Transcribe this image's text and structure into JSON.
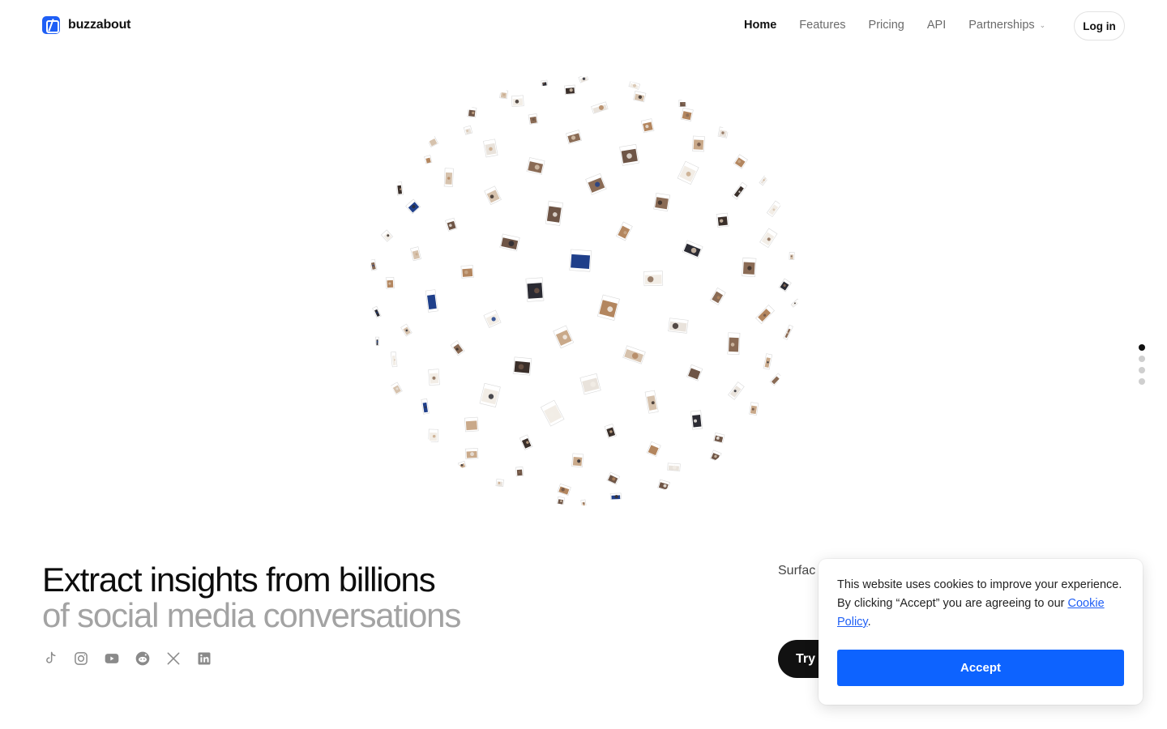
{
  "brand": {
    "name": "buzzabout"
  },
  "nav": {
    "items": [
      {
        "label": "Home",
        "active": true
      },
      {
        "label": "Features",
        "active": false
      },
      {
        "label": "Pricing",
        "active": false
      },
      {
        "label": "API",
        "active": false
      },
      {
        "label": "Partnerships",
        "active": false,
        "has_dropdown": true
      }
    ],
    "login_label": "Log in"
  },
  "hero": {
    "headline_line1": "Extract insights from billions",
    "headline_line2": "of social media conversations",
    "description_visible": "Surfac of soci every r",
    "cta_label": "Try f"
  },
  "socials": [
    "tiktok-icon",
    "instagram-icon",
    "youtube-icon",
    "reddit-icon",
    "x-icon",
    "linkedin-icon"
  ],
  "page_dots": {
    "count": 4,
    "active_index": 0
  },
  "cookie": {
    "text_before": "This website uses cookies to improve your experience. By clicking “Accept” you are agreeing to our ",
    "link_label": "Cookie Policy",
    "text_after": ".",
    "accept_label": "Accept"
  },
  "colors": {
    "brand_blue": "#1f5ff5",
    "accept_blue": "#0d63ff",
    "headline_primary": "#0d0d0d",
    "headline_secondary": "#a3a3a3",
    "cta_bg": "#111111"
  }
}
